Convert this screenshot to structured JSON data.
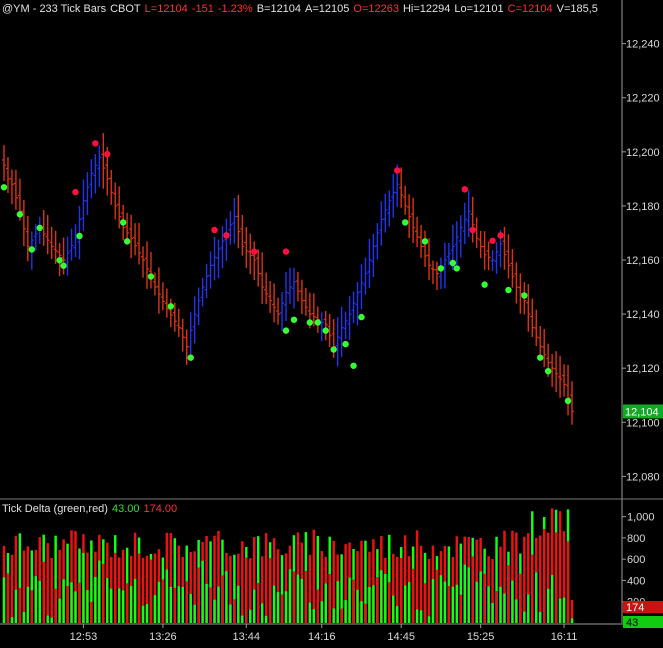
{
  "header": {
    "symbol": "@YM - 233 Tick Bars",
    "exchange": "CBOT",
    "last": "L=12104",
    "change": "-151",
    "change_pct": "-1.23%",
    "bid": "B=12104",
    "ask": "A=12105",
    "open": "O=12263",
    "high": "Hi=12294",
    "low": "Lo=12101",
    "close": "C=12104",
    "volume": "V=185,5"
  },
  "subpanel": {
    "title": "Tick Delta (green,red)",
    "green_value": "43.00",
    "red_value": "174.00",
    "green_badge": "43",
    "red_badge": "174"
  },
  "price_badge": "12,104",
  "colors": {
    "background": "#000000",
    "up_bar": "#2233ee",
    "down_bar": "#dd3311",
    "dot_high": "#ff1040",
    "dot_low": "#33ff33",
    "delta_green": "#11ff11",
    "delta_red": "#ee1111",
    "axis_text": "#d8d8d8"
  },
  "chart_data": [
    {
      "type": "ohlc",
      "ylim": [
        12072,
        12248
      ],
      "y_ticks": [
        "12,240",
        "12,220",
        "12,200",
        "12,180",
        "12,160",
        "12,140",
        "12,120",
        "12,100",
        "12,080"
      ],
      "y_tick_values": [
        12240,
        12220,
        12200,
        12180,
        12160,
        12140,
        12120,
        12100,
        12080
      ],
      "x_ticks": [
        "12:53",
        "13:26",
        "13:44",
        "14:16",
        "14:45",
        "15:25",
        "16:11"
      ],
      "x_tick_bar_index": [
        20,
        40,
        61,
        80,
        100,
        120,
        141
      ],
      "bar_count": 144,
      "close_anchors": [
        [
          0,
          12195
        ],
        [
          1,
          12190
        ],
        [
          2,
          12188
        ],
        [
          4,
          12178
        ],
        [
          6,
          12165
        ],
        [
          9,
          12172
        ],
        [
          12,
          12165
        ],
        [
          15,
          12160
        ],
        [
          18,
          12168
        ],
        [
          20,
          12182
        ],
        [
          22,
          12192
        ],
        [
          24,
          12198
        ],
        [
          26,
          12190
        ],
        [
          28,
          12180
        ],
        [
          30,
          12172
        ],
        [
          32,
          12168
        ],
        [
          35,
          12160
        ],
        [
          38,
          12150
        ],
        [
          41,
          12142
        ],
        [
          44,
          12135
        ],
        [
          46,
          12128
        ],
        [
          48,
          12140
        ],
        [
          50,
          12150
        ],
        [
          52,
          12158
        ],
        [
          54,
          12164
        ],
        [
          56,
          12170
        ],
        [
          58,
          12176
        ],
        [
          60,
          12165
        ],
        [
          63,
          12160
        ],
        [
          65,
          12150
        ],
        [
          67,
          12145
        ],
        [
          69,
          12140
        ],
        [
          71,
          12148
        ],
        [
          73,
          12152
        ],
        [
          75,
          12145
        ],
        [
          77,
          12140
        ],
        [
          79,
          12138
        ],
        [
          81,
          12136
        ],
        [
          83,
          12128
        ],
        [
          85,
          12135
        ],
        [
          87,
          12140
        ],
        [
          89,
          12148
        ],
        [
          91,
          12155
        ],
        [
          93,
          12165
        ],
        [
          95,
          12175
        ],
        [
          97,
          12182
        ],
        [
          99,
          12188
        ],
        [
          101,
          12180
        ],
        [
          103,
          12172
        ],
        [
          105,
          12165
        ],
        [
          107,
          12158
        ],
        [
          109,
          12155
        ],
        [
          111,
          12160
        ],
        [
          113,
          12165
        ],
        [
          115,
          12172
        ],
        [
          117,
          12178
        ],
        [
          119,
          12168
        ],
        [
          121,
          12162
        ],
        [
          123,
          12160
        ],
        [
          125,
          12166
        ],
        [
          127,
          12158
        ],
        [
          129,
          12150
        ],
        [
          131,
          12145
        ],
        [
          133,
          12135
        ],
        [
          135,
          12128
        ],
        [
          137,
          12122
        ],
        [
          139,
          12118
        ],
        [
          141,
          12114
        ],
        [
          143,
          12104
        ]
      ],
      "high_marks": [
        [
          18,
          12184
        ],
        [
          23,
          12202
        ],
        [
          26,
          12198
        ],
        [
          53,
          12170
        ],
        [
          56,
          12168
        ],
        [
          63,
          12162
        ],
        [
          71,
          12162
        ],
        [
          99,
          12192
        ],
        [
          116,
          12185
        ],
        [
          118,
          12170
        ],
        [
          123,
          12166
        ],
        [
          125,
          12168
        ]
      ],
      "low_marks": [
        [
          0,
          12188
        ],
        [
          4,
          12178
        ],
        [
          7,
          12165
        ],
        [
          9,
          12173
        ],
        [
          14,
          12161
        ],
        [
          15,
          12159
        ],
        [
          19,
          12170
        ],
        [
          30,
          12175
        ],
        [
          31,
          12168
        ],
        [
          37,
          12155
        ],
        [
          42,
          12144
        ],
        [
          47,
          12125
        ],
        [
          71,
          12135
        ],
        [
          73,
          12139
        ],
        [
          77,
          12138
        ],
        [
          79,
          12138
        ],
        [
          81,
          12135
        ],
        [
          83,
          12128
        ],
        [
          86,
          12130
        ],
        [
          88,
          12122
        ],
        [
          90,
          12140
        ],
        [
          101,
          12175
        ],
        [
          106,
          12168
        ],
        [
          110,
          12158
        ],
        [
          113,
          12160
        ],
        [
          114,
          12158
        ],
        [
          121,
          12152
        ],
        [
          127,
          12150
        ],
        [
          131,
          12148
        ],
        [
          135,
          12125
        ],
        [
          137,
          12120
        ],
        [
          142,
          12109
        ]
      ]
    },
    {
      "type": "bar",
      "title": "Tick Delta (green,red)",
      "ylim": [
        0,
        1100
      ],
      "y_ticks": [
        "1,000",
        "800",
        "600",
        "400",
        "200"
      ],
      "y_tick_values": [
        1000,
        800,
        600,
        400,
        200
      ],
      "bar_count": 144,
      "last_green": 43,
      "last_red": 174
    }
  ]
}
